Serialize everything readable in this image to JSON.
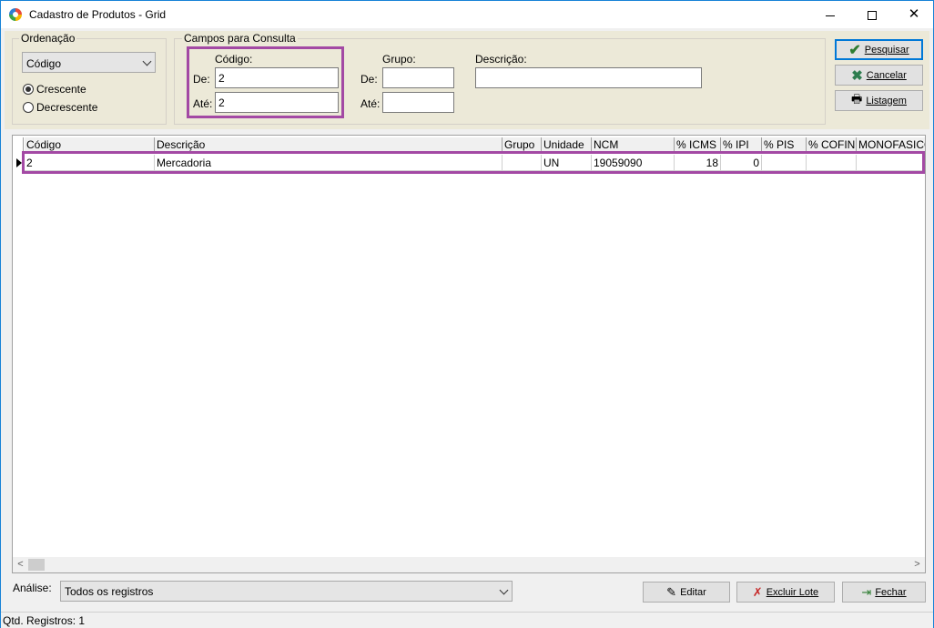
{
  "window": {
    "title": "Cadastro de Produtos - Grid"
  },
  "ordenacao": {
    "title": "Ordenação",
    "selected": "Código",
    "radio_asc": "Crescente",
    "radio_desc": "Decrescente"
  },
  "consulta": {
    "title": "Campos para Consulta",
    "codigo_label": "Código:",
    "de_label": "De:",
    "ate_label": "Até:",
    "codigo_de": "2",
    "codigo_ate": "2",
    "grupo_label": "Grupo:",
    "grupo_de": "",
    "grupo_ate": "",
    "descricao_label": "Descrição:",
    "descricao": ""
  },
  "actions": {
    "pesquisar": "Pesquisar",
    "cancelar": "Cancelar",
    "listagem": "Listagem"
  },
  "grid": {
    "columns": [
      "Código",
      "Descrição",
      "Grupo",
      "Unidade",
      "NCM",
      "% ICMS",
      "% IPI",
      "% PIS",
      "% COFIN",
      "MONOFASICO"
    ],
    "rows": [
      [
        "2",
        "Mercadoria",
        "",
        "UN",
        "19059090",
        "18",
        "0",
        "",
        "",
        ""
      ]
    ]
  },
  "bottom": {
    "analise_label": "Análise:",
    "analise_value": "Todos os registros",
    "editar": "Editar",
    "excluir_lote": "Excluir Lote",
    "fechar": "Fechar"
  },
  "status": {
    "qtd": "Qtd. Registros: 1"
  },
  "colors": {
    "highlight": "#a349a4",
    "panel": "#ece9d8",
    "accent": "#0078d7"
  }
}
